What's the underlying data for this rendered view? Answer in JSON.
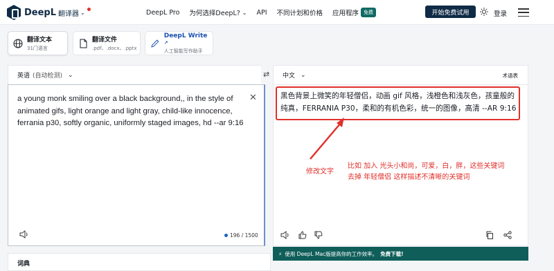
{
  "header": {
    "brand": "DeepL",
    "translator_menu": "翻译器",
    "nav": [
      "DeepL Pro",
      "为何选择DeepL?",
      "API",
      "不同计划和价格",
      "应用程序"
    ],
    "apps_badge": "免费",
    "cta": "开始免费试用",
    "login": "登录"
  },
  "modes": [
    {
      "title": "翻译文本",
      "sub": "31门语言"
    },
    {
      "title": "翻译文件",
      "sub": ".pdf、.docx、.pptx"
    },
    {
      "title": "DeepL Write",
      "sub": "人工智能写作助手"
    }
  ],
  "source": {
    "lang": "英语",
    "auto": "(自动检测)",
    "text": "a young monk smiling over a black background,, in the style of animated gifs, light orange and light gray, child-like innocence, ferrania p30, softly organic, uniformly staged images, hd --ar 9:16",
    "char_count": "196 / 1500"
  },
  "target": {
    "lang": "中文",
    "glossary": "术语表",
    "text": "黑色背景上微笑的年轻僧侣，动画 gif 风格，浅橙色和浅灰色，孩童般的纯真，FERRANIA P30，柔和的有机色彩，统一的图像，高清 --AR 9:16"
  },
  "annotation": {
    "label": "修改文字",
    "note_line1": "比如 加入 光头小和尚，可爱，白，胖，这些关键词",
    "note_line2": "去掉 年轻僧侣 这样描述不清晰的关键词"
  },
  "banner": {
    "text": "使用 DeepL Mac版提高你的工作效率。",
    "link": "免费下载!"
  },
  "dictionary": {
    "title": "词典"
  },
  "colors": {
    "brand": "#0f2b46",
    "accent_teal": "#0f5e5a",
    "annotation_red": "#e0302b"
  }
}
